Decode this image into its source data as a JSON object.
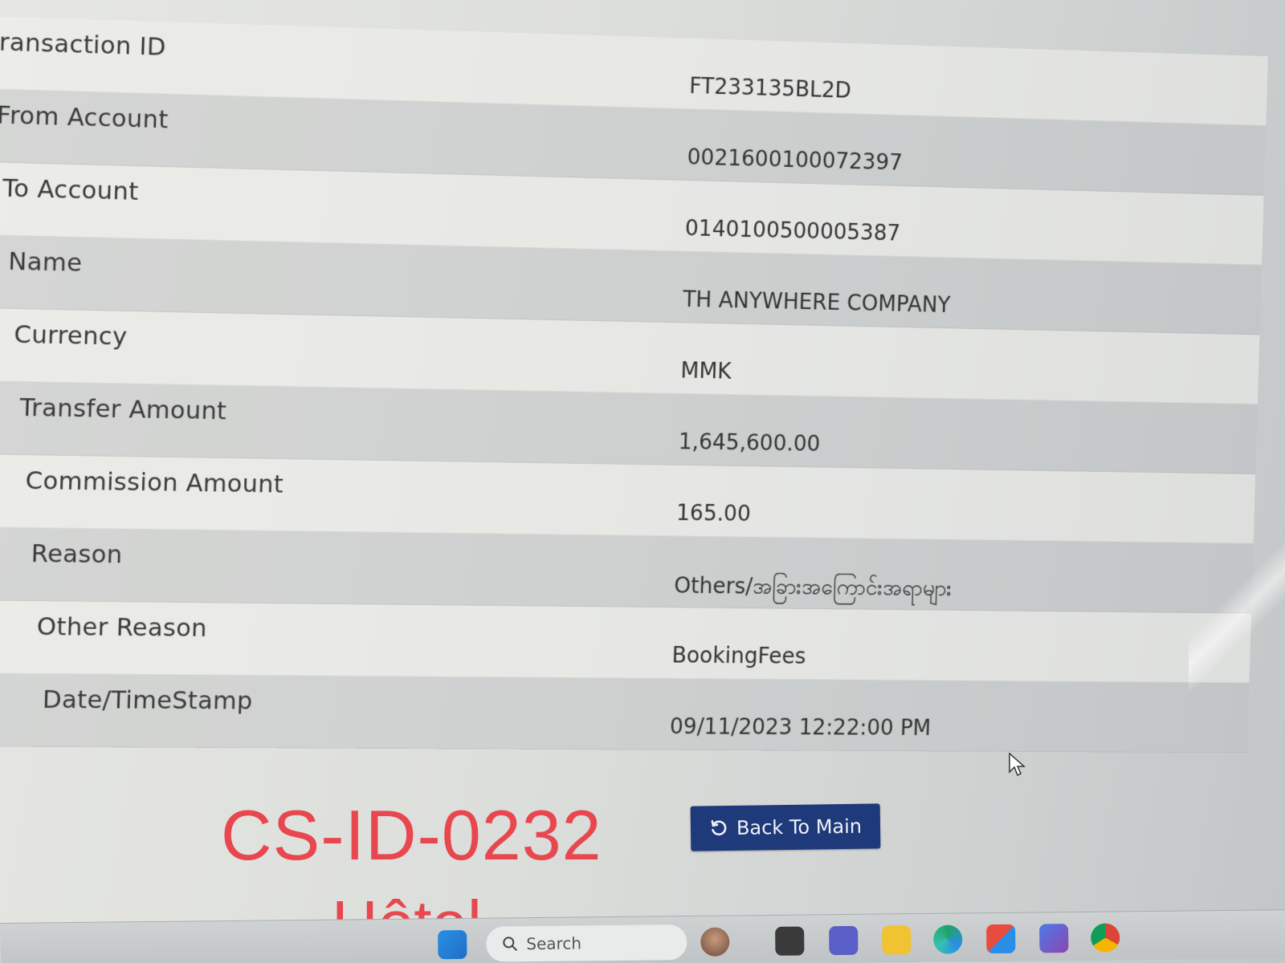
{
  "details": {
    "rows": [
      {
        "label": "ransaction ID",
        "value": "FT233135BL2D"
      },
      {
        "label": "From Account",
        "value": "0021600100072397"
      },
      {
        "label": "To Account",
        "value": "0140100500005387"
      },
      {
        "label": "Name",
        "value": "TH ANYWHERE COMPANY"
      },
      {
        "label": "Currency",
        "value": "MMK"
      },
      {
        "label": "Transfer Amount",
        "value": "1,645,600.00"
      },
      {
        "label": "Commission Amount",
        "value": "165.00"
      },
      {
        "label": "Reason",
        "value": "Others/အခြားအကြောင်းအရာများ"
      },
      {
        "label": "Other Reason",
        "value": "BookingFees"
      },
      {
        "label": "Date/TimeStamp",
        "value": "09/11/2023 12:22:00 PM"
      }
    ]
  },
  "actions": {
    "back_label": "Back To Main"
  },
  "overlay": {
    "id_text": "CS-ID-0232",
    "hotel_text": "Hôtel"
  },
  "taskbar": {
    "search_placeholder": "Search",
    "icons": [
      "windows-start-icon",
      "search-icon",
      "avatar-icon",
      "task-view-icon",
      "teams-icon",
      "file-explorer-icon",
      "edge-icon",
      "store-icon",
      "copilot-icon",
      "chrome-icon"
    ]
  },
  "colors": {
    "button_bg": "#1f3a7a",
    "watermark": "#e8474f"
  }
}
